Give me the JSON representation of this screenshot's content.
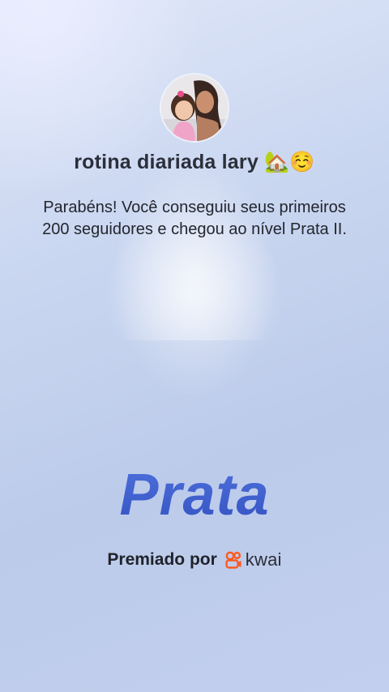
{
  "profile": {
    "username": "rotina diariada lary 🏡☺️"
  },
  "achievement": {
    "message": "Parabéns! Você conseguiu seus primeiros 200 seguidores e chegou ao nível Prata II.",
    "level_title": "Prata"
  },
  "award": {
    "label": "Premiado por",
    "brand": "kwai",
    "brand_logo": "kwai-logo-icon",
    "brand_color": "#ff5a1f"
  },
  "colors": {
    "level_title": "#3f5fcc",
    "text": "#23262e"
  }
}
